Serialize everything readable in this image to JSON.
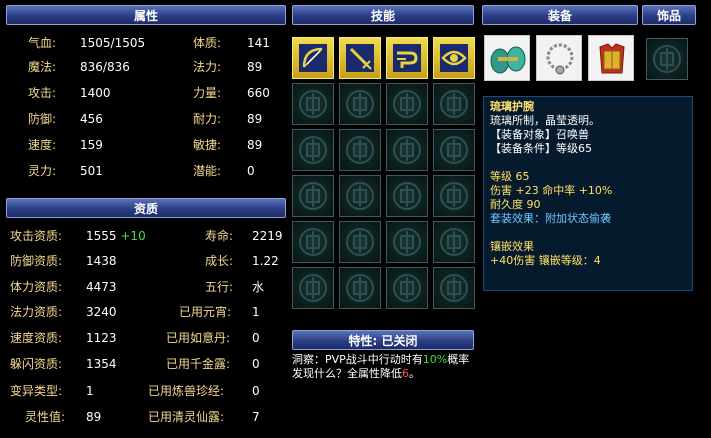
{
  "headers": {
    "attributes": "属性",
    "skills": "技能",
    "equipment": "装备",
    "accessory": "饰品",
    "aptitude": "资质",
    "trait": "特性: 已关闭"
  },
  "attributes": [
    {
      "label": "气血:",
      "value": "1505/1505"
    },
    {
      "label": "体质:",
      "value": "141"
    },
    {
      "label": "魔法:",
      "value": "836/836"
    },
    {
      "label": "法力:",
      "value": "89"
    },
    {
      "label": "攻击:",
      "value": "1400"
    },
    {
      "label": "力量:",
      "value": "660"
    },
    {
      "label": "防御:",
      "value": "456"
    },
    {
      "label": "耐力:",
      "value": "89"
    },
    {
      "label": "速度:",
      "value": "159"
    },
    {
      "label": "敏捷:",
      "value": "89"
    },
    {
      "label": "灵力:",
      "value": "501"
    },
    {
      "label": "潜能:",
      "value": "0"
    }
  ],
  "aptitude": [
    {
      "label": "攻击资质:",
      "value": "1555",
      "bonus": "+10"
    },
    {
      "label": "寿命:",
      "value": "2219"
    },
    {
      "label": "防御资质:",
      "value": "1438"
    },
    {
      "label": "成长:",
      "value": "1.22"
    },
    {
      "label": "体力资质:",
      "value": "4473"
    },
    {
      "label": "五行:",
      "value": "水"
    },
    {
      "label": "法力资质:",
      "value": "3240"
    },
    {
      "label": "已用元宵:",
      "value": "1"
    },
    {
      "label": "速度资质:",
      "value": "1123"
    },
    {
      "label": "已用如意丹:",
      "value": "0"
    },
    {
      "label": "躲闪资质:",
      "value": "1354"
    },
    {
      "label": "已用千金露:",
      "value": "0"
    },
    {
      "label": "变异类型:",
      "value": "1"
    },
    {
      "label": "已用炼兽珍经:",
      "value": "0"
    },
    {
      "label": "灵性值:",
      "value": "89"
    },
    {
      "label": "已用清灵仙露:",
      "value": "7"
    }
  ],
  "skills": [
    "bow-skill-icon",
    "sword-skill-icon",
    "magic-skill-icon",
    "eye-skill-icon"
  ],
  "equipment": [
    "bracer-icon",
    "necklace-icon",
    "armor-icon"
  ],
  "item_info": {
    "name": "琉璃护腕",
    "desc": "琉璃所制，晶莹透明。",
    "target": "【装备对象】召唤兽",
    "condition": "【装备条件】等级65",
    "level": "等级 65",
    "damage": "伤害 +23 命中率 +10%",
    "durability": "耐久度 90",
    "set_effect": "套装效果：附加状态偷袭",
    "inlay_title": "镶嵌效果",
    "inlay_value": "+40伤害 镶嵌等级：4"
  },
  "trait": {
    "prefix": "洞察：PVP战斗中行动时有",
    "pct": "10%",
    "middle": "概率发现什么？全属性降低",
    "num": "6",
    "suffix": "。"
  },
  "colors": {
    "header": "#2c3f86",
    "label": "#f4d890",
    "value": "#ffffff",
    "bonus": "#3fe03f",
    "info_bg": "#061a2e",
    "skill_bg": "#e0c030"
  }
}
